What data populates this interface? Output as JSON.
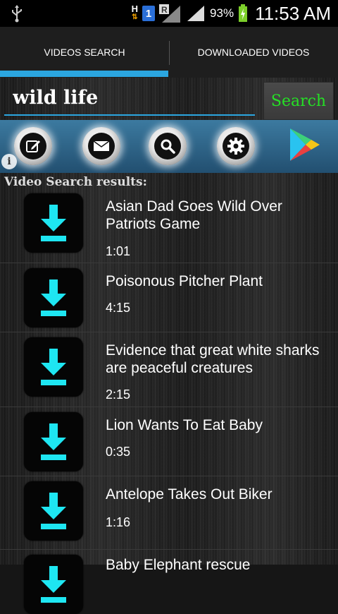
{
  "status_bar": {
    "network": "H",
    "sim_slot": "1",
    "roaming": "R",
    "battery_percent": "93%",
    "time": "11:53 AM"
  },
  "tabs": [
    {
      "label": "VIDEOS SEARCH",
      "active": true
    },
    {
      "label": "DOWNLOADED VIDEOS",
      "active": false
    }
  ],
  "search": {
    "value": "wild life",
    "button_label": "Search"
  },
  "toolbar": {
    "buttons": [
      "edit-icon",
      "mail-icon",
      "search-icon",
      "settings-icon",
      "play-store-icon"
    ]
  },
  "info_glyph": "i",
  "results_label": "Video Search results:",
  "results": [
    {
      "title": "Asian Dad Goes Wild Over Patriots Game",
      "duration": "1:01"
    },
    {
      "title": "Poisonous Pitcher Plant",
      "duration": "4:15"
    },
    {
      "title": "Evidence that great white sharks are peaceful creatures",
      "duration": "2:15"
    },
    {
      "title": "Lion Wants To Eat Baby",
      "duration": "0:35"
    },
    {
      "title": "Antelope Takes Out Biker",
      "duration": "1:16"
    },
    {
      "title": "Baby Elephant rescue",
      "duration": ""
    }
  ],
  "colors": {
    "accent_blue": "#2ba6e0",
    "download_cyan": "#1ee6f2",
    "search_green": "#25e025",
    "toolbar_blue": "#2f6a90"
  }
}
